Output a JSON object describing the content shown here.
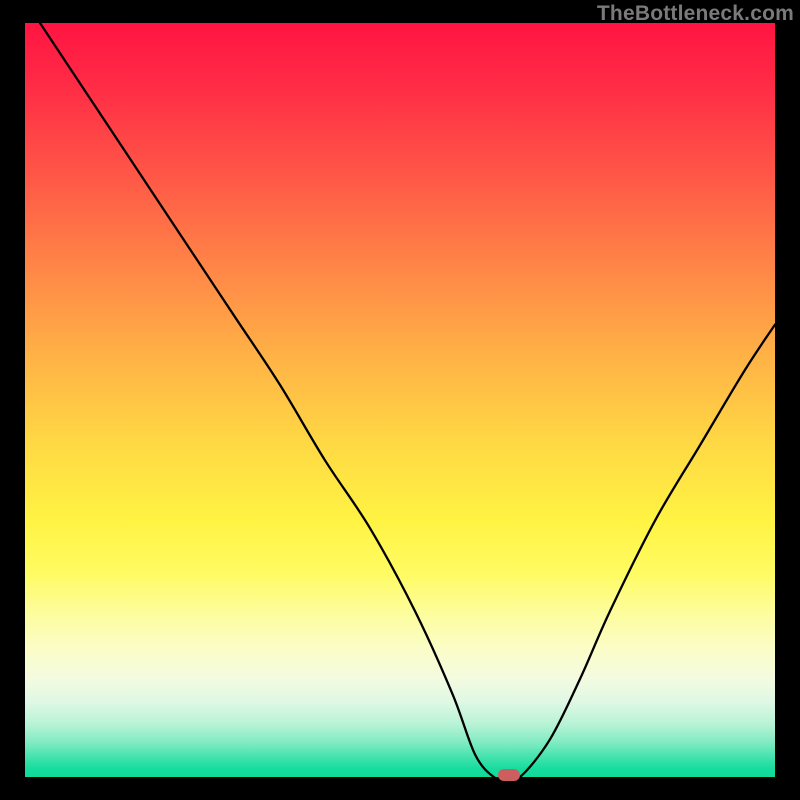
{
  "watermark": "TheBottleneck.com",
  "chart_data": {
    "type": "line",
    "title": "",
    "xlabel": "",
    "ylabel": "",
    "xlim": [
      0,
      100
    ],
    "ylim": [
      0,
      100
    ],
    "grid": false,
    "legend": false,
    "x": [
      2,
      12,
      22,
      28,
      34,
      40,
      46,
      52,
      57,
      60,
      62.5,
      64,
      66,
      70,
      74,
      78,
      84,
      90,
      96,
      100
    ],
    "values": [
      100,
      85,
      70,
      61,
      52,
      42,
      33,
      22,
      11,
      3,
      0,
      0,
      0,
      5,
      13,
      22,
      34,
      44,
      54,
      60
    ],
    "marker": {
      "x": 64.5,
      "y": 0
    },
    "background_gradient_stops": [
      {
        "pos": 0,
        "color": "#ff1442"
      },
      {
        "pos": 0.2,
        "color": "#ff5647"
      },
      {
        "pos": 0.44,
        "color": "#ffb146"
      },
      {
        "pos": 0.66,
        "color": "#fff343"
      },
      {
        "pos": 0.83,
        "color": "#fbfdc7"
      },
      {
        "pos": 0.93,
        "color": "#b8f3d6"
      },
      {
        "pos": 1.0,
        "color": "#11db9a"
      }
    ]
  }
}
